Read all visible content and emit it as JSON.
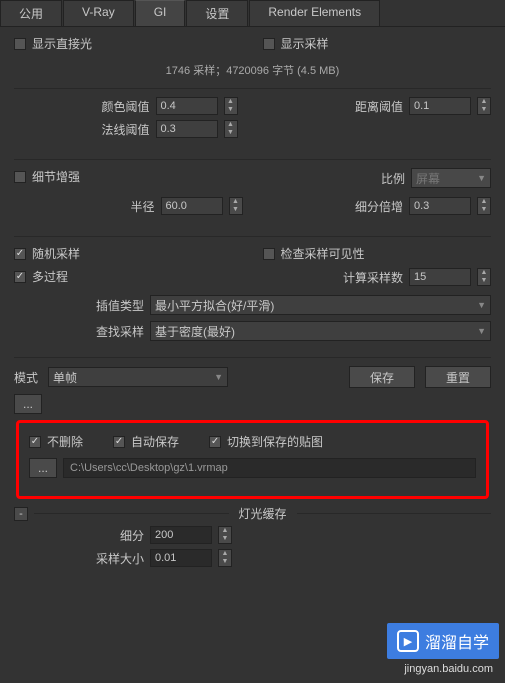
{
  "tabs": {
    "common": "公用",
    "vray": "V-Ray",
    "gi": "GI",
    "settings": "设置",
    "render_elements": "Render Elements"
  },
  "show_direct_light": "显示直接光",
  "show_samples": "显示采样",
  "sample_info": "1746 采样；4720096 字节 (4.5 MB)",
  "color_threshold_label": "颜色阈值",
  "color_threshold": "0.4",
  "normal_threshold_label": "法线阈值",
  "normal_threshold": "0.3",
  "distance_threshold_label": "距离阈值",
  "distance_threshold": "0.1",
  "detail_enhance": "细节增强",
  "scale_label": "比例",
  "scale_value": "屏幕",
  "radius_label": "半径",
  "radius": "60.0",
  "subdiv_mult_label": "细分倍增",
  "subdiv_mult": "0.3",
  "random_sampling": "随机采样",
  "check_sample_visibility": "检查采样可见性",
  "multipass": "多过程",
  "calc_samples_label": "计算采样数",
  "calc_samples": "15",
  "interp_type_label": "插值类型",
  "interp_type": "最小平方拟合(好/平滑)",
  "lookup_label": "查找采样",
  "lookup": "基于密度(最好)",
  "mode_label": "模式",
  "mode_value": "单帧",
  "save_btn": "保存",
  "reset_btn": "重置",
  "dont_delete": "不删除",
  "auto_save": "自动保存",
  "switch_saved": "切换到保存的贴图",
  "path": "C:\\Users\\cc\\Desktop\\gz\\1.vrmap",
  "light_cache_title": "灯光缓存",
  "subdiv_label": "细分",
  "subdiv": "200",
  "sample_size_label": "采样大小",
  "sample_size": "0.01",
  "watermark": "溜溜自学",
  "watermark_sub": "jingyan.baidu.com",
  "ellipsis": "..."
}
